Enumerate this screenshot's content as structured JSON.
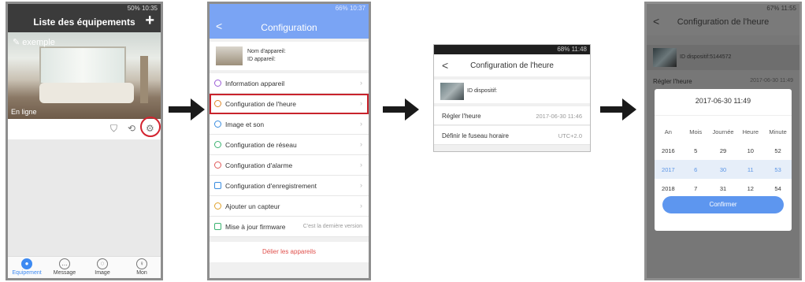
{
  "screen1": {
    "status": "50% 10:35",
    "title": "Liste des équipements",
    "plus": "+",
    "device_name": "exemple",
    "online": "En ligne",
    "tabs": [
      {
        "label": "Equipement",
        "glyph": "●"
      },
      {
        "label": "Message",
        "glyph": "…"
      },
      {
        "label": "Image",
        "glyph": "◌"
      },
      {
        "label": "Mon",
        "glyph": "♀"
      }
    ]
  },
  "screen2": {
    "status": "66% 10:37",
    "back": "<",
    "title": "Configuration",
    "device_name_label": "Nom d'appareil:",
    "device_id_label": "ID appareil:",
    "items": [
      {
        "label": "Information appareil",
        "color": "#9b5cd6"
      },
      {
        "label": "Configuration de l'heure",
        "color": "#e08a2b"
      },
      {
        "label": "Image et son",
        "color": "#3a8de0"
      },
      {
        "label": "Configuration de réseau",
        "color": "#3cb371"
      },
      {
        "label": "Configuration d'alarme",
        "color": "#e05a5a"
      },
      {
        "label": "Configuration d'enregistrement",
        "color": "#3a8de0"
      },
      {
        "label": "Ajouter un capteur",
        "color": "#e0a22b"
      },
      {
        "label": "Mise à jour firmware",
        "color": "#3cb371",
        "note": "C'est la dernière version"
      }
    ],
    "unbind": "Délier les appareils"
  },
  "screen3": {
    "status": "68% 11:48",
    "back": "<",
    "title": "Configuration de l'heure",
    "device_id": "ID dispositif:",
    "set_time_label": "Régler l'heure",
    "set_time_value": "2017-06-30 11:46",
    "timezone_label": "Définir le fuseau horaire",
    "timezone_value": "UTC+2.0"
  },
  "screen4": {
    "status": "67% 11:55",
    "back": "<",
    "title": "Configuration de l'heure",
    "device_id": "ID dispositif:5144572",
    "set_time_label": "Régler l'heure",
    "set_time_value": "2017-06-30 11:49",
    "dialog_title": "2017-06-30 11:49",
    "columns": [
      "An",
      "Mois",
      "Journée",
      "Heure",
      "Minute"
    ],
    "rows": [
      [
        "2016",
        "5",
        "29",
        "10",
        "52"
      ],
      [
        "2017",
        "6",
        "30",
        "11",
        "53"
      ],
      [
        "2018",
        "7",
        "31",
        "12",
        "54"
      ]
    ],
    "confirm": "Confirmer"
  }
}
